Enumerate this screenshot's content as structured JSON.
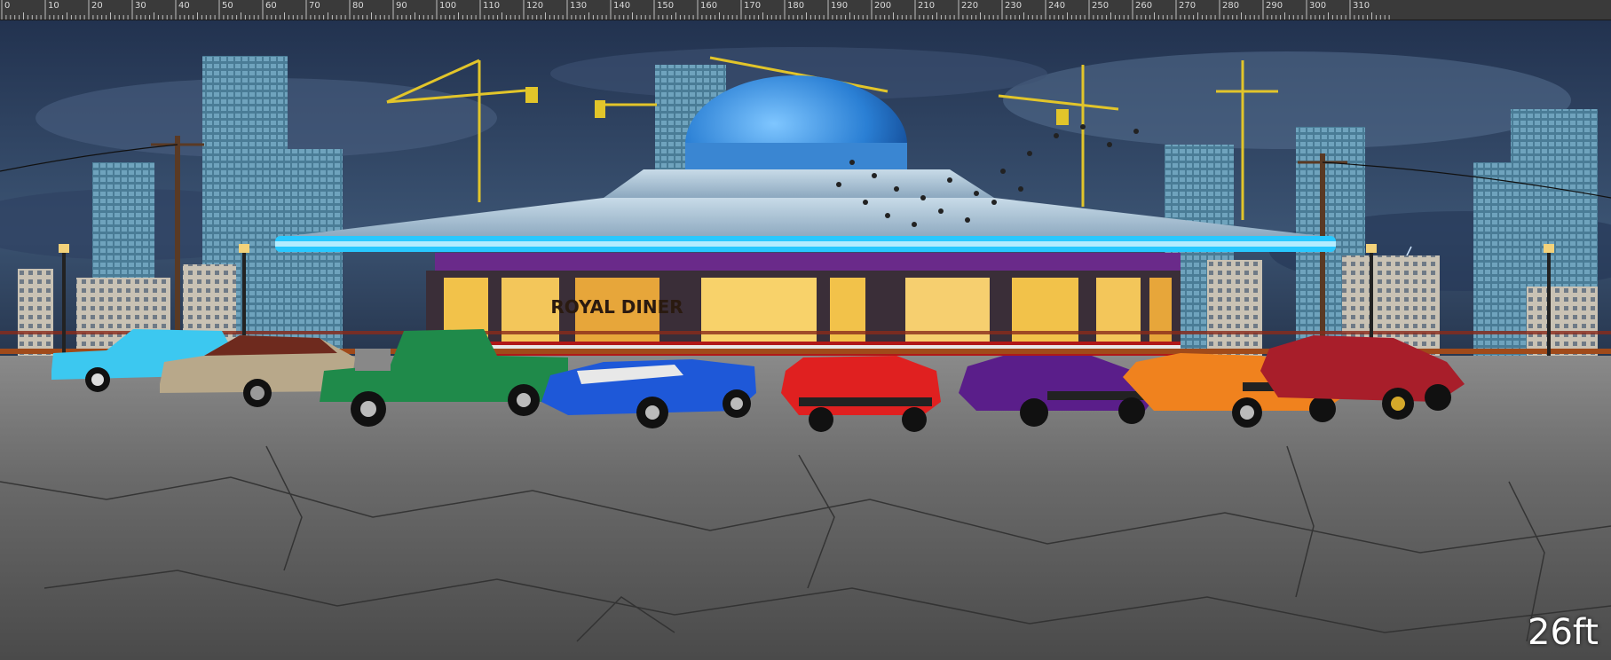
{
  "ruler": {
    "unit": "ft",
    "labels": [
      "0",
      "10",
      "20",
      "30",
      "40",
      "50",
      "60",
      "70",
      "80",
      "90",
      "100",
      "110",
      "120",
      "130",
      "140",
      "150",
      "160",
      "170",
      "180",
      "190",
      "200",
      "210",
      "220",
      "230",
      "240",
      "250",
      "260",
      "270",
      "280",
      "290",
      "300",
      "310"
    ]
  },
  "canvas": {
    "scale_label": "26ft",
    "diner_sign": "ROYAL DINER"
  },
  "colors": {
    "sky": "#1b2a45",
    "neon": "#28c8ff",
    "asphalt": "#6d6d6d",
    "crane": "#e2c52a"
  },
  "cars": [
    {
      "name": "light-blue-pickup",
      "color": "#3cc8f0"
    },
    {
      "name": "beige-hot-rod",
      "color": "#b8a88a"
    },
    {
      "name": "green-truck",
      "color": "#1f8a4a"
    },
    {
      "name": "blue-cobra",
      "color": "#1e58d8"
    },
    {
      "name": "red-camaro",
      "color": "#e02020"
    },
    {
      "name": "purple-muscle-car",
      "color": "#5a1e8a"
    },
    {
      "name": "orange-mustang",
      "color": "#f0821e"
    },
    {
      "name": "dark-red-coupe",
      "color": "#a81e2a"
    }
  ]
}
